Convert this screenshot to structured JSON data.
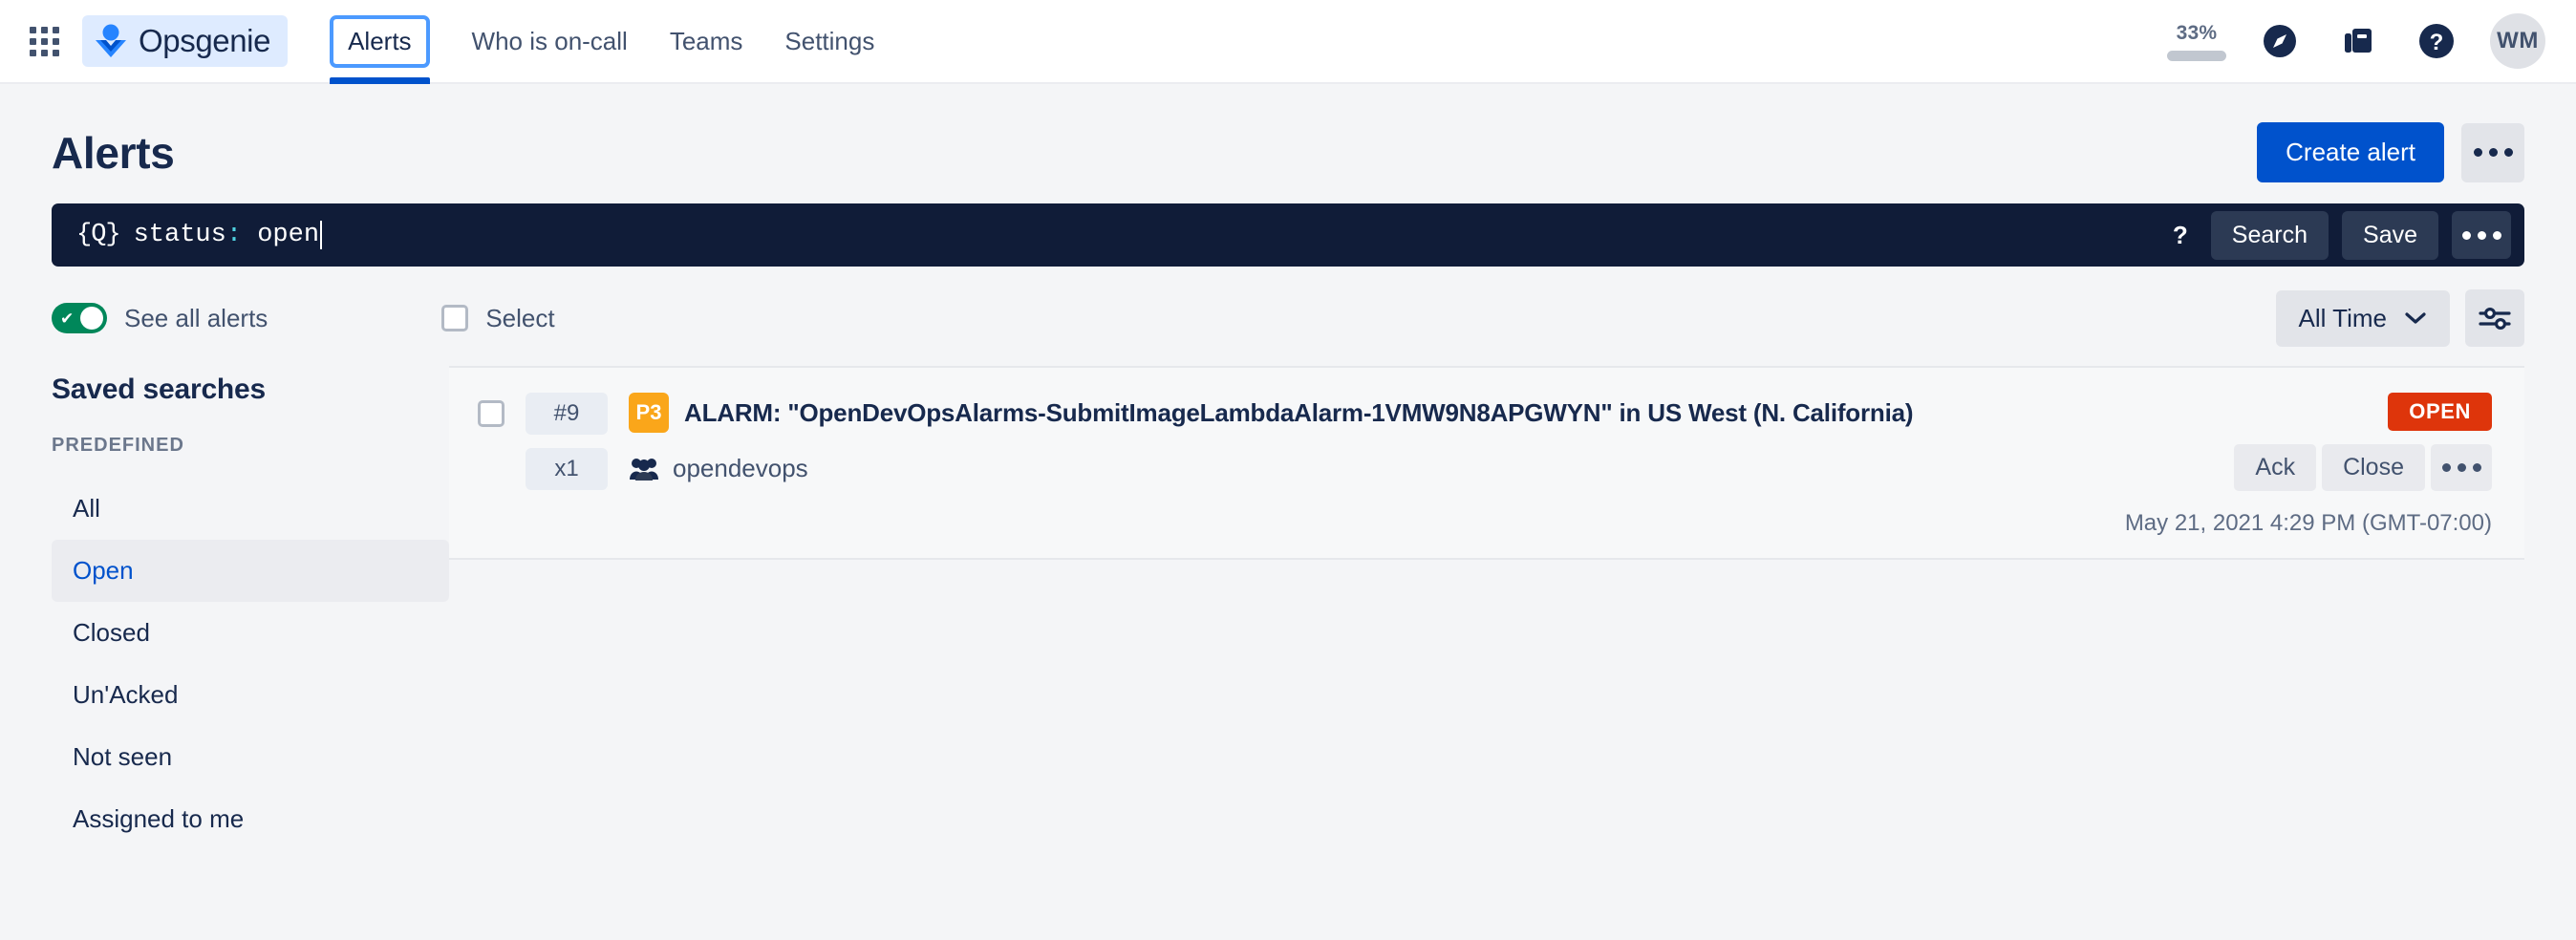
{
  "topnav": {
    "app_switcher_label": "app-switcher",
    "brand": "Opsgenie",
    "tabs": [
      {
        "label": "Alerts",
        "active": true
      },
      {
        "label": "Who is on-call",
        "active": false
      },
      {
        "label": "Teams",
        "active": false
      },
      {
        "label": "Settings",
        "active": false
      }
    ],
    "progress_percent": "33%",
    "progress_value": 33,
    "avatar_initials": "WM"
  },
  "page": {
    "title": "Alerts",
    "create_alert_label": "Create alert"
  },
  "search": {
    "query_icon": "{Q}",
    "query_key": "status",
    "query_separator": ":",
    "query_value": " open",
    "help_label": "?",
    "search_label": "Search",
    "save_label": "Save"
  },
  "toolbar": {
    "see_all_alerts_label": "See all alerts",
    "see_all_alerts_on": true,
    "select_label": "Select",
    "time_filter": "All Time"
  },
  "sidebar": {
    "title": "Saved searches",
    "section_label": "PREDEFINED",
    "items": [
      {
        "label": "All",
        "selected": false
      },
      {
        "label": "Open",
        "selected": true
      },
      {
        "label": "Closed",
        "selected": false
      },
      {
        "label": "Un'Acked",
        "selected": false
      },
      {
        "label": "Not seen",
        "selected": false
      },
      {
        "label": "Assigned to me",
        "selected": false
      }
    ]
  },
  "alerts": [
    {
      "id_chip": "#9",
      "count_chip": "x1",
      "priority": "P3",
      "priority_color": "#faa61a",
      "title": "ALARM: \"OpenDevOpsAlarms-SubmitImageLambdaAlarm-1VMW9N8APGWYN\" in US West (N. California)",
      "owner": "opendevops",
      "status": "OPEN",
      "status_color": "#de350b",
      "ack_label": "Ack",
      "close_label": "Close",
      "timestamp": "May 21, 2021 4:29 PM (GMT-07:00)"
    }
  ],
  "colors": {
    "brand_blue": "#0052cc",
    "nav_focus": "#4c9aff",
    "search_bg": "#101c38",
    "toggle_green": "#00875a",
    "page_bg": "#f4f5f7"
  }
}
